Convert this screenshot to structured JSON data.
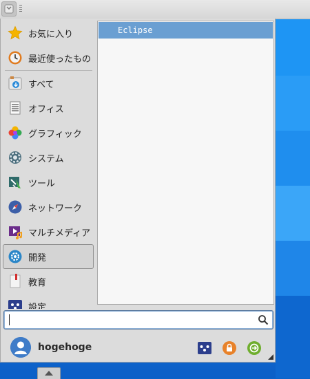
{
  "categories": [
    {
      "label": "お気に入り",
      "icon": "star-icon"
    },
    {
      "label": "最近使ったもの",
      "icon": "recent-icon"
    },
    {
      "label": "すべて",
      "icon": "all-apps-icon"
    },
    {
      "label": "オフィス",
      "icon": "office-icon"
    },
    {
      "label": "グラフィック",
      "icon": "graphics-icon"
    },
    {
      "label": "システム",
      "icon": "system-gear-icon"
    },
    {
      "label": "ツール",
      "icon": "tools-icon"
    },
    {
      "label": "ネットワーク",
      "icon": "network-icon"
    },
    {
      "label": "マルチメディア",
      "icon": "multimedia-icon"
    },
    {
      "label": "開発",
      "icon": "development-icon",
      "selected": true
    },
    {
      "label": "教育",
      "icon": "education-icon"
    },
    {
      "label": "設定",
      "icon": "settings-icon"
    }
  ],
  "apps": [
    {
      "label": "Eclipse",
      "selected": true
    }
  ],
  "search": {
    "value": "",
    "placeholder": ""
  },
  "user": {
    "name": "hogehoge"
  },
  "footer_actions": [
    {
      "name": "settings-manager-button",
      "icon": "settings-manager-icon"
    },
    {
      "name": "lock-screen-button",
      "icon": "lock-icon"
    },
    {
      "name": "logout-button",
      "icon": "logout-icon"
    }
  ],
  "colors": {
    "selection": "#6a9fd2",
    "menu_bg": "#dcdcdc",
    "desktop": "#1e8ef0"
  }
}
